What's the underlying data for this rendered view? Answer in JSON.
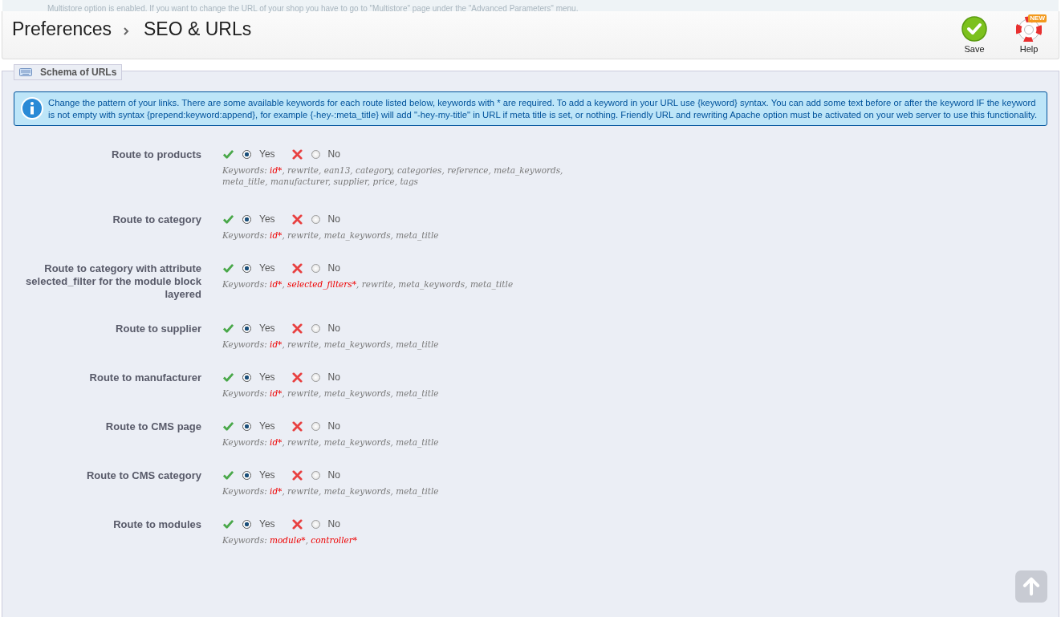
{
  "notice": {
    "text": "Multistore option is enabled. If you want to change the URL of your shop you have to go to \"Multistore\" page under the \"Advanced Parameters\" menu."
  },
  "breadcrumb": [
    "Preferences",
    "SEO & URLs"
  ],
  "toolbar": [
    {
      "kind": "save",
      "label": "Save"
    },
    {
      "kind": "help",
      "label": "Help",
      "badge": "NEW"
    }
  ],
  "fieldset": {
    "legend": "Schema of URLs",
    "info": "Change the pattern of your links. There are some available keywords for each route listed below, keywords with * are required. To add a keyword in your URL use {keyword} syntax. You can add some text before or after the keyword IF the keyword is not empty with syntax {prepend:keyword:append}, for example {-hey-:meta_title} will add \"-hey-my-title\" in URL if meta title is set, or nothing. Friendly URL and rewriting Apache option must be activated on your web server to use this functionality.",
    "routes": [
      {
        "label": "Route to products",
        "options": [
          {
            "kind": "yes",
            "label": "Yes",
            "selected": true
          },
          {
            "kind": "no",
            "label": "No",
            "selected": false
          }
        ],
        "keywords": [
          {
            "text": "Keywords: ",
            "required": false
          },
          {
            "text": "id*",
            "required": true
          },
          {
            "text": ", rewrite, ean13, category, categories, reference, meta_keywords, meta_title, manufacturer, supplier, price, tags",
            "required": false
          }
        ]
      },
      {
        "label": "Route to category",
        "options": [
          {
            "kind": "yes",
            "label": "Yes",
            "selected": true
          },
          {
            "kind": "no",
            "label": "No",
            "selected": false
          }
        ],
        "keywords": [
          {
            "text": "Keywords: ",
            "required": false
          },
          {
            "text": "id*",
            "required": true
          },
          {
            "text": ", rewrite, meta_keywords, meta_title",
            "required": false
          }
        ]
      },
      {
        "label": "Route to category with attribute selected_filter for the module block layered",
        "options": [
          {
            "kind": "yes",
            "label": "Yes",
            "selected": true
          },
          {
            "kind": "no",
            "label": "No",
            "selected": false
          }
        ],
        "keywords": [
          {
            "text": "Keywords: ",
            "required": false
          },
          {
            "text": "id*",
            "required": true
          },
          {
            "text": ", ",
            "required": false
          },
          {
            "text": "selected_filters*",
            "required": true
          },
          {
            "text": ", rewrite, meta_keywords, meta_title",
            "required": false
          }
        ]
      },
      {
        "label": "Route to supplier",
        "options": [
          {
            "kind": "yes",
            "label": "Yes",
            "selected": true
          },
          {
            "kind": "no",
            "label": "No",
            "selected": false
          }
        ],
        "keywords": [
          {
            "text": "Keywords: ",
            "required": false
          },
          {
            "text": "id*",
            "required": true
          },
          {
            "text": ", rewrite, meta_keywords, meta_title",
            "required": false
          }
        ]
      },
      {
        "label": "Route to manufacturer",
        "options": [
          {
            "kind": "yes",
            "label": "Yes",
            "selected": true
          },
          {
            "kind": "no",
            "label": "No",
            "selected": false
          }
        ],
        "keywords": [
          {
            "text": "Keywords: ",
            "required": false
          },
          {
            "text": "id*",
            "required": true
          },
          {
            "text": ", rewrite, meta_keywords, meta_title",
            "required": false
          }
        ]
      },
      {
        "label": "Route to CMS page",
        "options": [
          {
            "kind": "yes",
            "label": "Yes",
            "selected": true
          },
          {
            "kind": "no",
            "label": "No",
            "selected": false
          }
        ],
        "keywords": [
          {
            "text": "Keywords: ",
            "required": false
          },
          {
            "text": "id*",
            "required": true
          },
          {
            "text": ", rewrite, meta_keywords, meta_title",
            "required": false
          }
        ]
      },
      {
        "label": "Route to CMS category",
        "options": [
          {
            "kind": "yes",
            "label": "Yes",
            "selected": true
          },
          {
            "kind": "no",
            "label": "No",
            "selected": false
          }
        ],
        "keywords": [
          {
            "text": "Keywords: ",
            "required": false
          },
          {
            "text": "id*",
            "required": true
          },
          {
            "text": ", rewrite, meta_keywords, meta_title",
            "required": false
          }
        ]
      },
      {
        "label": "Route to modules",
        "options": [
          {
            "kind": "yes",
            "label": "Yes",
            "selected": true
          },
          {
            "kind": "no",
            "label": "No",
            "selected": false
          }
        ],
        "keywords": [
          {
            "text": "Keywords: ",
            "required": false
          },
          {
            "text": "module*",
            "required": true
          },
          {
            "text": ", ",
            "required": false
          },
          {
            "text": "controller*",
            "required": true
          }
        ]
      }
    ]
  }
}
